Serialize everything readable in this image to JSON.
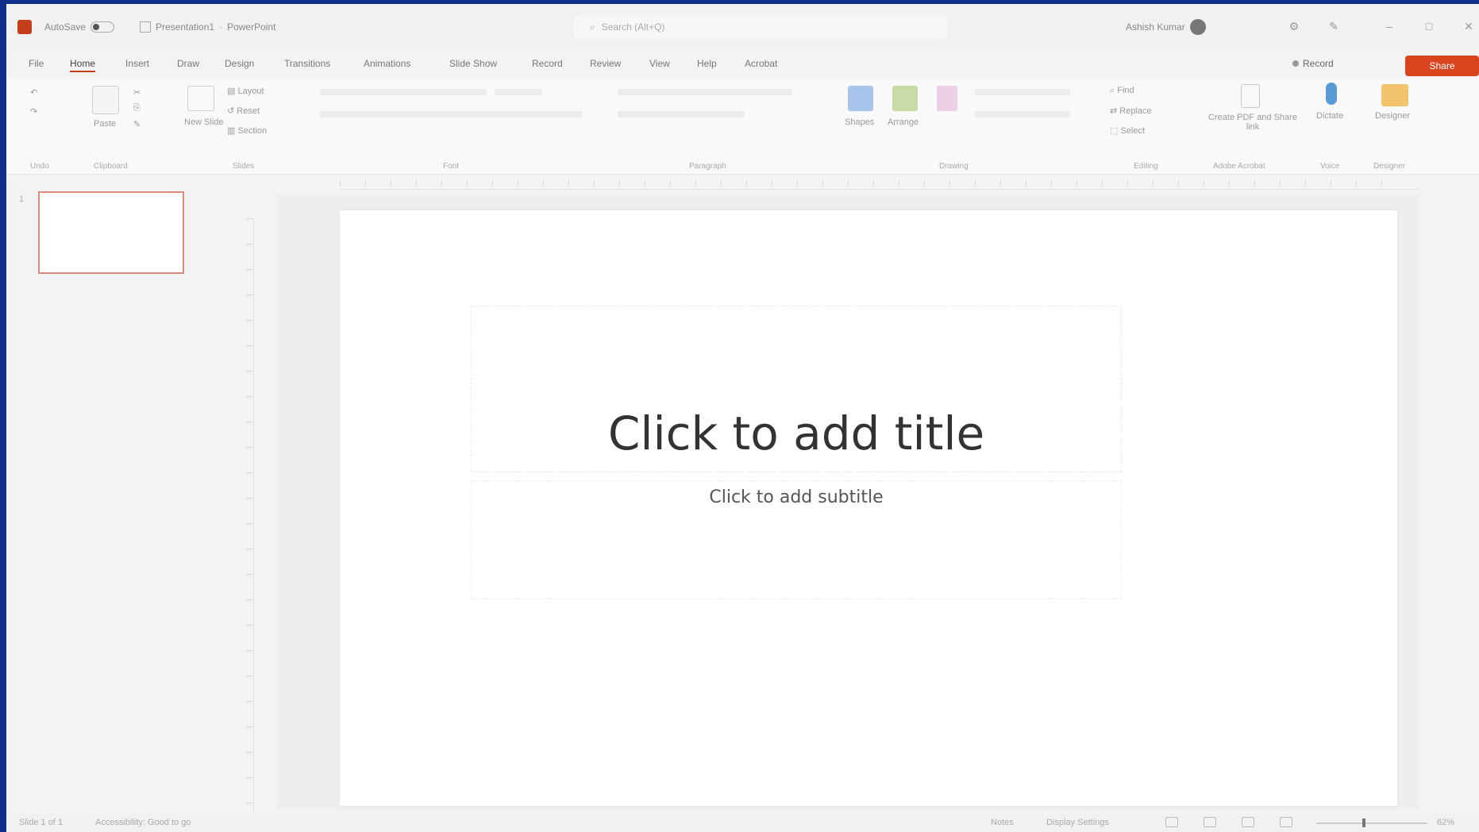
{
  "titlebar": {
    "autosave_label": "AutoSave",
    "file_name": "Presentation1",
    "app_name": "PowerPoint",
    "search_placeholder": "Search (Alt+Q)",
    "user_name": "Ashish Kumar"
  },
  "tabs": [
    "File",
    "Home",
    "Insert",
    "Draw",
    "Design",
    "Transitions",
    "Animations",
    "Slide Show",
    "Record",
    "Review",
    "View",
    "Help",
    "Acrobat"
  ],
  "active_tab": "Home",
  "record_label": "Record",
  "share_label": "Share",
  "ribbon": {
    "groups": [
      "Undo",
      "Clipboard",
      "Slides",
      "Font",
      "Paragraph",
      "Drawing",
      "Editing",
      "Adobe Acrobat",
      "Voice",
      "Designer"
    ],
    "paste_label": "Paste",
    "new_slide_label": "New Slide",
    "layout_label": "Layout",
    "reset_label": "Reset",
    "section_label": "Section",
    "shapes_label": "Shapes",
    "arrange_label": "Arrange",
    "find_label": "Find",
    "replace_label": "Replace",
    "select_label": "Select",
    "acrobat_label": "Create PDF and Share link",
    "dictate_label": "Dictate",
    "designer_label": "Designer"
  },
  "slide": {
    "number": "1",
    "title_placeholder": "Click to add title",
    "subtitle_placeholder": "Click to add subtitle"
  },
  "statusbar": {
    "slide_count": "Slide 1 of 1",
    "accessibility": "Accessibility: Good to go",
    "notes_label": "Notes",
    "display_settings": "Display Settings",
    "zoom": "62%"
  },
  "colors": {
    "accent": "#c43e1c",
    "share_button": "#d9431e",
    "frame": "#0f2f8a"
  }
}
